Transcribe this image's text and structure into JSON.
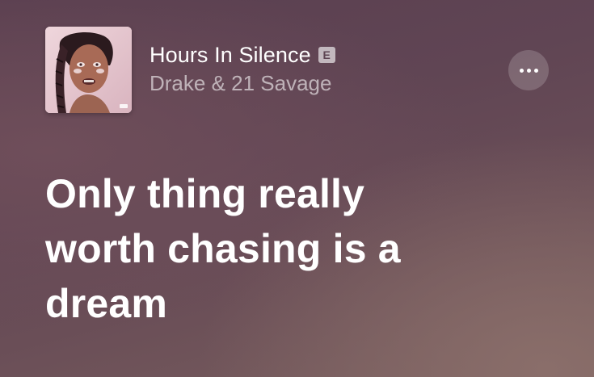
{
  "track": {
    "title": "Hours In Silence",
    "explicit_badge": "E",
    "artist": "Drake & 21 Savage",
    "album_art_icon": "album-cover-portrait"
  },
  "actions": {
    "more_icon": "ellipsis-icon"
  },
  "lyrics": {
    "lines": [
      "Only thing really",
      "worth chasing is a",
      "dream"
    ]
  },
  "colors": {
    "background_top": "#5a3f50",
    "background_bottom": "#785e5e",
    "artist_text": "rgba(255,255,255,0.58)",
    "lyric_text": "#ffffff"
  }
}
